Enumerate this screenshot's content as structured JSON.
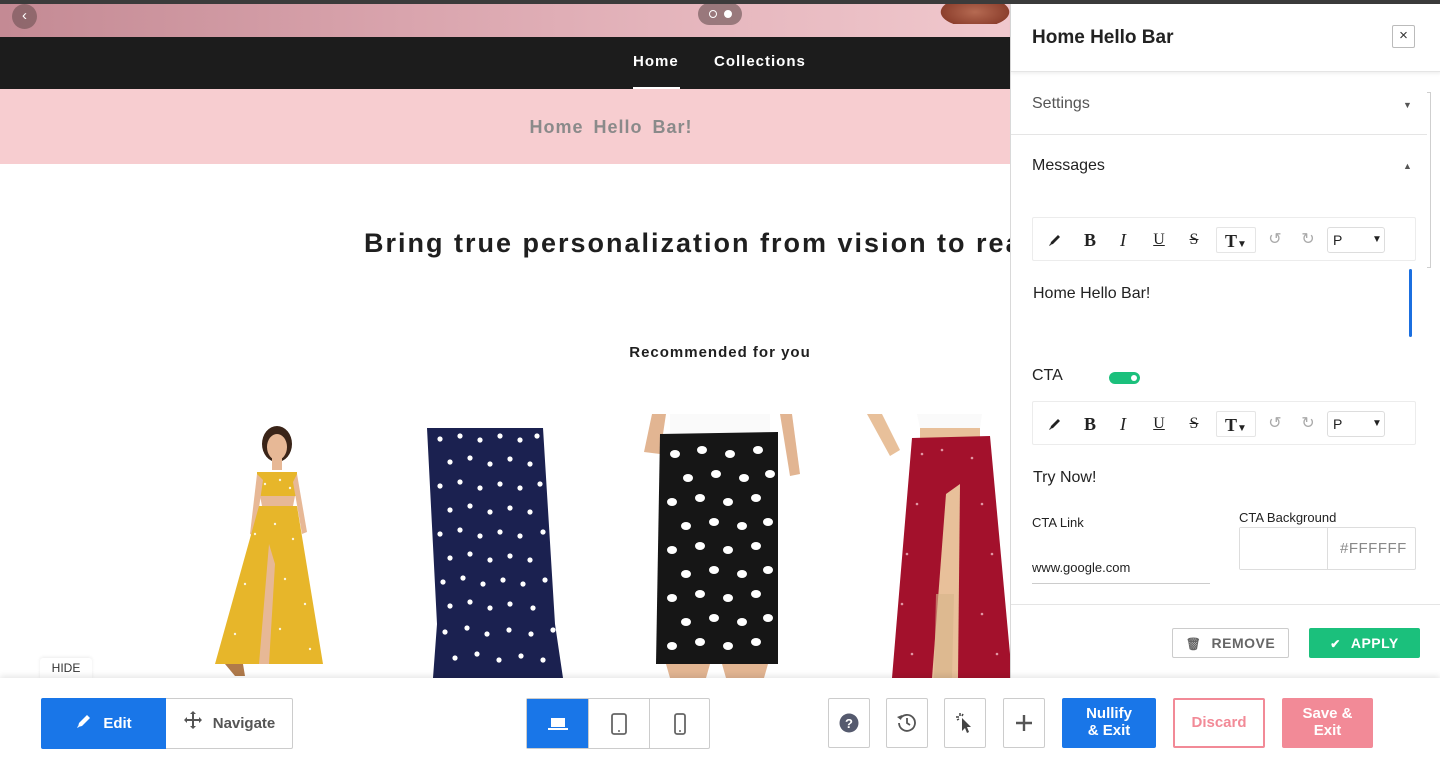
{
  "store": {
    "nav": {
      "home": "Home",
      "collections": "Collections"
    },
    "hello_bar": "Home  Hello  Bar!",
    "tagline": "Bring true personalization from vision to rea",
    "recommended_title": "Recommended for you"
  },
  "panel": {
    "title": "Home Hello Bar",
    "close_icon": "×",
    "settings_label": "Settings",
    "messages_label": "Messages",
    "message_text": "Home Hello Bar!",
    "cta_label": "CTA",
    "cta_enabled": true,
    "cta_text": "Try Now!",
    "cta_link_label": "CTA Link",
    "cta_link_value": "www.google.com",
    "cta_background_label": "CTA Background",
    "cta_background_hex": "#FFFFFF",
    "toolbar": {
      "bold": "B",
      "italic": "I",
      "underline": "U",
      "strike": "S",
      "text_size": "T",
      "format": "P"
    },
    "remove_label": "REMOVE",
    "apply_label": "APPLY"
  },
  "bottom": {
    "hide_label": "HIDE",
    "edit_label": "Edit",
    "navigate_label": "Navigate",
    "help_icon": "?",
    "add_icon": "+",
    "nullify_line1": "Nullify",
    "nullify_line2": "& Exit",
    "discard_label": "Discard",
    "save_line1": "Save &",
    "save_line2": "Exit"
  },
  "colors": {
    "accent_blue": "#1976e8",
    "apply_green": "#1bc07c",
    "discard_pink": "#f28a97",
    "hello_bar_bg": "#f7cdd0",
    "nav_bg": "#1c1c1c"
  }
}
